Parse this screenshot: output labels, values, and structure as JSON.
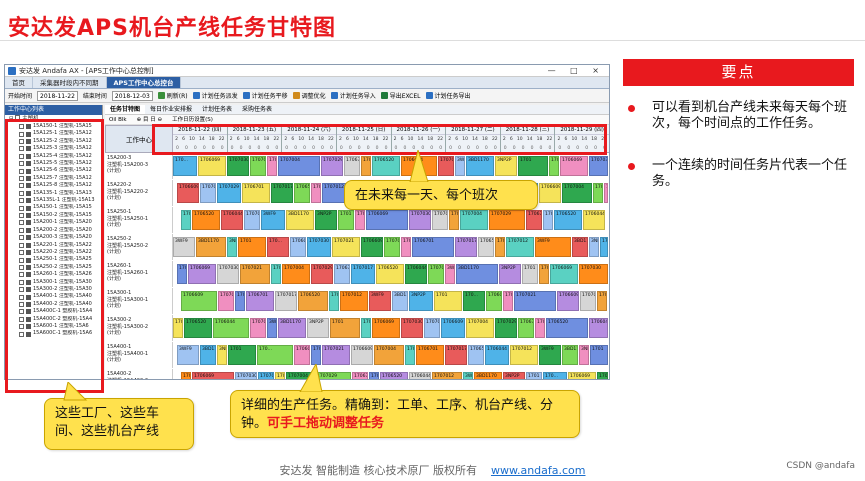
{
  "slide_title": "安达发APS机台产线任务甘特图",
  "window": {
    "title": "安达发 Andafa AX - [APS工作中心总控制]",
    "controls": "— □ ×",
    "tabs": [
      "首页",
      "采集器时段内不同期",
      "APS工作中心总控台"
    ],
    "toolbar": {
      "start_label": "开始时间",
      "start_value": "2018-11-22",
      "end_label": "结束时间",
      "end_value": "2018-12-03",
      "buttons": [
        "刷新(R)",
        "计划任务派发",
        "计划任务平移",
        "调整优化",
        "计划任务导入",
        "导出EXCEL",
        "计划任务导出"
      ]
    },
    "sidebar": {
      "header": "工作中心列表",
      "root": "主塑机",
      "items": [
        "15A150-1  注塑机-15A15",
        "15A125-1  注塑机-15A12",
        "15A125-2  注塑机-15A12",
        "15A125-3  注塑机-15A12",
        "15A125-4  注塑机-15A12",
        "15A125-5  注塑机-15A12",
        "15A125-6  注塑机-15A12",
        "15A125-7  注塑机-15A12",
        "15A125-8  注塑机-15A12",
        "15A135-1  注塑机-15A13",
        "15A135L-1 注塑机-15A13",
        "15A150-1  注塑机-15A15",
        "15A150-2  注塑机-15A15",
        "15A200-1  注塑机-15A20",
        "15A200-2  注塑机-15A20",
        "15A200-3  注塑机-15A20",
        "15A220-1  注塑机-15A22",
        "15A220-2  注塑机-15A22",
        "15A250-1  注塑机-15A25",
        "15A250-2  注塑机-15A25",
        "15A260-1  注塑机-15A26",
        "15A300-1  注塑机-15A30",
        "15A300-2  注塑机-15A30",
        "15A400-1  注塑机-15A40",
        "15A400-2  注塑机-15A40",
        "15A400C-1 塑胶机-15A4",
        "15A400C-2 塑胶机-15A4",
        "15A600-1  注塑机-15A6",
        "15A600C-1 塑胶机-15A6"
      ]
    },
    "subtabs": [
      "任务甘特图",
      "每日作业安排报",
      "计划任务表",
      "采购任务表"
    ],
    "subtool": [
      "Oil Blk",
      "⊕ 目 日 ⊖",
      "工作日历设置(S)"
    ],
    "gantt_header": "工作中心",
    "days": [
      {
        "date": "2018-11-22",
        "wd": "(四)"
      },
      {
        "date": "2018-11-23",
        "wd": "(五)"
      },
      {
        "date": "2018-11-24",
        "wd": "(六)"
      },
      {
        "date": "2018-11-25",
        "wd": "(日)"
      },
      {
        "date": "2018-11-26",
        "wd": "(一)"
      },
      {
        "date": "2018-11-27",
        "wd": "(二)"
      },
      {
        "date": "2018-11-28",
        "wd": "(三)"
      },
      {
        "date": "2018-11-29",
        "wd": "(四)"
      }
    ],
    "shifts": [
      "2",
      "6",
      "10",
      "14",
      "18",
      "22"
    ],
    "shift_counts": [
      "0",
      "0",
      "0",
      "0",
      "0",
      "0"
    ],
    "rows": [
      {
        "label": "15A200-3\n注塑机-15A200-3\n(计划)"
      },
      {
        "label": "15A220-2\n注塑机-15A220-2\n(计划)"
      },
      {
        "label": "15A250-1\n注塑机-15A250-1\n(计划)"
      },
      {
        "label": "15A250-2\n注塑机-15A250-2\n(计划)"
      },
      {
        "label": "15A260-1\n注塑机-15A260-1\n(计划)"
      },
      {
        "label": "15A300-1\n注塑机-15A300-1\n(计划)"
      },
      {
        "label": "15A300-2\n注塑机-15A300-2\n(计划)"
      },
      {
        "label": "15A400-1\n注塑机-15A400-1\n(计划)"
      },
      {
        "label": "15A400-2\n注塑机-15A400-2\n(计划)"
      }
    ],
    "task_codes": [
      "170...",
      "1706069",
      "1707030",
      "1707021",
      "1706609",
      "1707004",
      "1707029",
      "1706701",
      "1707017",
      "1706520",
      "1706044",
      "1707012",
      "3WF9",
      "3BD1170",
      "3NP2P",
      "1701"
    ]
  },
  "callouts": {
    "top": "在未来每一天、每个班次",
    "left": "这些工厂、这些车间、这些机台产线",
    "bottom_plain": "详细的生产任务。精确到：工单、工序、机台产线、分钟。",
    "bottom_red": "可手工拖动调整任务"
  },
  "key_points": {
    "header": "要点",
    "bullets": [
      "可以看到机台产线未来每天每个班次，每个时间点的工作任务。",
      "一个连续的时间任务片代表一个任务。"
    ]
  },
  "footer": {
    "text": "安达发   智能制造 核心技术原厂   版权所有",
    "link": "www.andafa.com",
    "watermark": "CSDN @andafa"
  },
  "colors": {
    "accent_red": "#e8191e",
    "callout_yellow": "#ffe14d",
    "window_blue": "#2d5fa4"
  }
}
